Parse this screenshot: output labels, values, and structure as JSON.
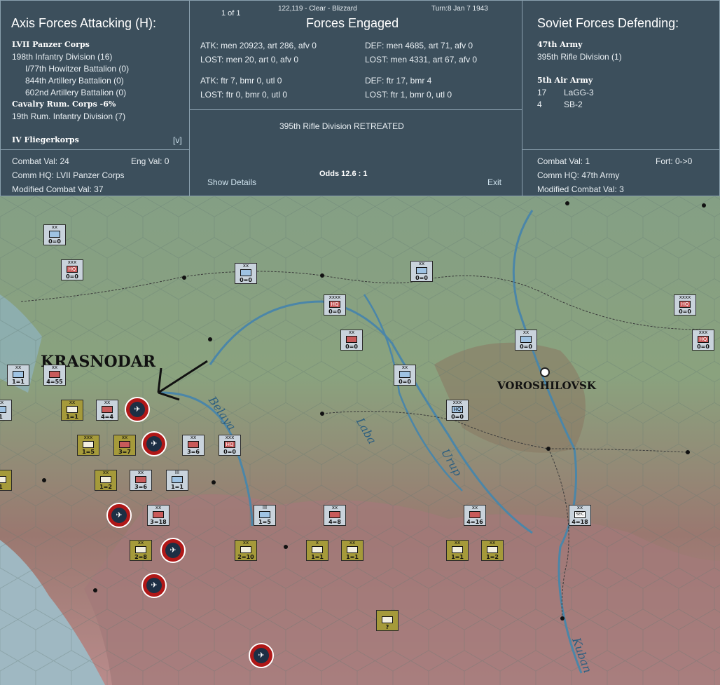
{
  "left": {
    "title": "Axis Forces Attacking (H):",
    "corps1": "LVII Panzer Corps",
    "div1": "198th Infantry Division (16)",
    "sub1": "I/77th Howitzer Battalion (0)",
    "sub2": "844th Artillery Battalion (0)",
    "sub3": "602nd Artillery Battalion (0)",
    "corps2": "Cavalry Rum. Corps  -6%",
    "div2": "19th Rum. Infantry Division (7)",
    "air": "IV Fliegerkorps",
    "toggle": "[v]",
    "combat_val": "Combat Val: 24",
    "eng_val": "Eng Val: 0",
    "comm_hq": "Comm HQ: LVII Panzer Corps",
    "mod_cv": "Modified Combat Val: 37"
  },
  "mid": {
    "page": "1 of 1",
    "coords": "122,119 - Clear - Blizzard",
    "turn": "Turn:8  Jan 7 1943",
    "title": "Forces Engaged",
    "atk": "ATK: men 20923, art 286, afv 0",
    "def": "DEF: men 4685, art 71, afv 0",
    "atk_lost": "LOST: men 20, art 0, afv 0",
    "def_lost": "LOST: men 4331, art 67, afv 0",
    "atk_air": "ATK: ftr 7, bmr 0, utl 0",
    "def_air": "DEF: ftr 17, bmr 4",
    "atk_air_lost": "LOST: ftr 0, bmr 0, utl 0",
    "def_air_lost": "LOST: ftr 1, bmr 0, utl 0",
    "result": "395th Rifle Division RETREATED",
    "show_details": "Show Details",
    "odds": "Odds 12.6 : 1",
    "exit": "Exit"
  },
  "right": {
    "title": "Soviet Forces Defending:",
    "army": "47th Army",
    "div": "395th Rifle Division (1)",
    "air_army": "5th Air Army",
    "air1_n": "17",
    "air1": "LaGG-3",
    "air2_n": "4",
    "air2": "SB-2",
    "combat_val": "Combat Val: 1",
    "fort": "Fort: 0->0",
    "comm_hq": "Comm HQ: 47th Army",
    "mod_cv": "Modified Combat Val: 3"
  },
  "map": {
    "cities": [
      "KRASNODAR",
      "VOROSHILOVSK"
    ],
    "rivers": [
      "Belaya",
      "Laba",
      "Urup",
      "Kuban"
    ],
    "colors": {
      "soviet_counter": "#c9d3dc",
      "axis_counter": "#a59a3a",
      "air_ring": "#b01818",
      "panel": "#3c4f5c"
    }
  },
  "units": [
    {
      "ech": "xx",
      "val": "0=0",
      "t": "sov blue"
    },
    {
      "ech": "xxx",
      "val": "0=0",
      "t": "sov hq"
    },
    {
      "ech": "xx",
      "val": "0=0",
      "t": "sov blue"
    },
    {
      "ech": "xx",
      "val": "0=0",
      "t": "sov blue"
    },
    {
      "ech": "xxxx",
      "val": "0=0",
      "t": "sov hq"
    },
    {
      "ech": "xx",
      "val": "0=0",
      "t": "sov red"
    },
    {
      "ech": "xx",
      "val": "0=0",
      "t": "sov blue"
    },
    {
      "ech": "xxx",
      "val": "0=0",
      "t": "sov hq"
    },
    {
      "ech": "xx",
      "val": "0=0",
      "t": "sov blue"
    },
    {
      "ech": "xxxx",
      "val": "0=0",
      "t": "sov hq"
    },
    {
      "ech": "xxx",
      "val": "0=0",
      "t": "sov hqb"
    },
    {
      "ech": "xx",
      "val": "1=1",
      "t": "sov blue"
    },
    {
      "ech": "xx",
      "val": "4=55",
      "t": "sov red"
    },
    {
      "ech": "xx",
      "val": "4=4",
      "t": "sov red"
    },
    {
      "ech": "xx",
      "val": "3=6",
      "t": "sov red"
    },
    {
      "ech": "xxx",
      "val": "0=0",
      "t": "sov hq"
    },
    {
      "ech": "xx",
      "val": "3=6",
      "t": "sov red"
    },
    {
      "ech": "III",
      "val": "1=1",
      "t": "sov blue"
    },
    {
      "ech": "xx",
      "val": "3=18",
      "t": "sov red"
    },
    {
      "ech": "III",
      "val": "1=5",
      "t": "sov blue"
    },
    {
      "ech": "xx",
      "val": "4=8",
      "t": "sov red"
    },
    {
      "ech": "xx",
      "val": "4=16",
      "t": "sov red"
    },
    {
      "ech": "xx",
      "val": "4=18",
      "t": "sov sec"
    },
    {
      "ech": "xx",
      "val": "1=1",
      "t": "ax"
    },
    {
      "ech": "xxx",
      "val": "1=5",
      "t": "ax"
    },
    {
      "ech": "xx",
      "val": "3=7",
      "t": "ax red"
    },
    {
      "ech": "xx",
      "val": "1=2",
      "t": "ax"
    },
    {
      "ech": "xx",
      "val": "2=8",
      "t": "ax"
    },
    {
      "ech": "xx",
      "val": "2=10",
      "t": "ax"
    },
    {
      "ech": "x",
      "val": "1=1",
      "t": "ax"
    },
    {
      "ech": "xx",
      "val": "1=1",
      "t": "ax"
    },
    {
      "ech": "xx",
      "val": "1=1",
      "t": "ax"
    },
    {
      "ech": "xx",
      "val": "1=2",
      "t": "ax"
    },
    {
      "ech": "",
      "val": "?",
      "t": "ax"
    },
    {
      "ech": "xx",
      "val": "1",
      "t": "sov blue"
    },
    {
      "ech": "",
      "val": "1",
      "t": "ax"
    }
  ]
}
